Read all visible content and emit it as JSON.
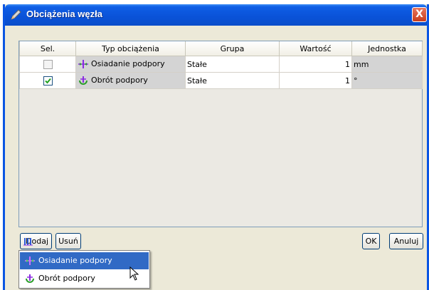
{
  "window": {
    "title": "Obciążenia węzła",
    "close_label": "X"
  },
  "table": {
    "headers": [
      "Sel.",
      "Typ obciążenia",
      "Grupa",
      "Wartość",
      "Jednostka"
    ],
    "rows": [
      {
        "selected": false,
        "type": "Osiadanie podpory",
        "group": "Stałe",
        "value": "1",
        "unit": "mm"
      },
      {
        "selected": true,
        "type": "Obrót podpory",
        "group": "Stałe",
        "value": "1",
        "unit": "°"
      }
    ]
  },
  "buttons": {
    "add": "Dodaj",
    "remove": "Usuń",
    "ok": "OK",
    "cancel": "Anuluj"
  },
  "menu": {
    "items": [
      "Osiadanie podpory",
      "Obrót podpory"
    ],
    "highlighted_index": 0
  },
  "colors": {
    "title_bar": "#0a52d8",
    "menu_highlight": "#316ac5",
    "grey_cell": "#d4d4d4"
  }
}
